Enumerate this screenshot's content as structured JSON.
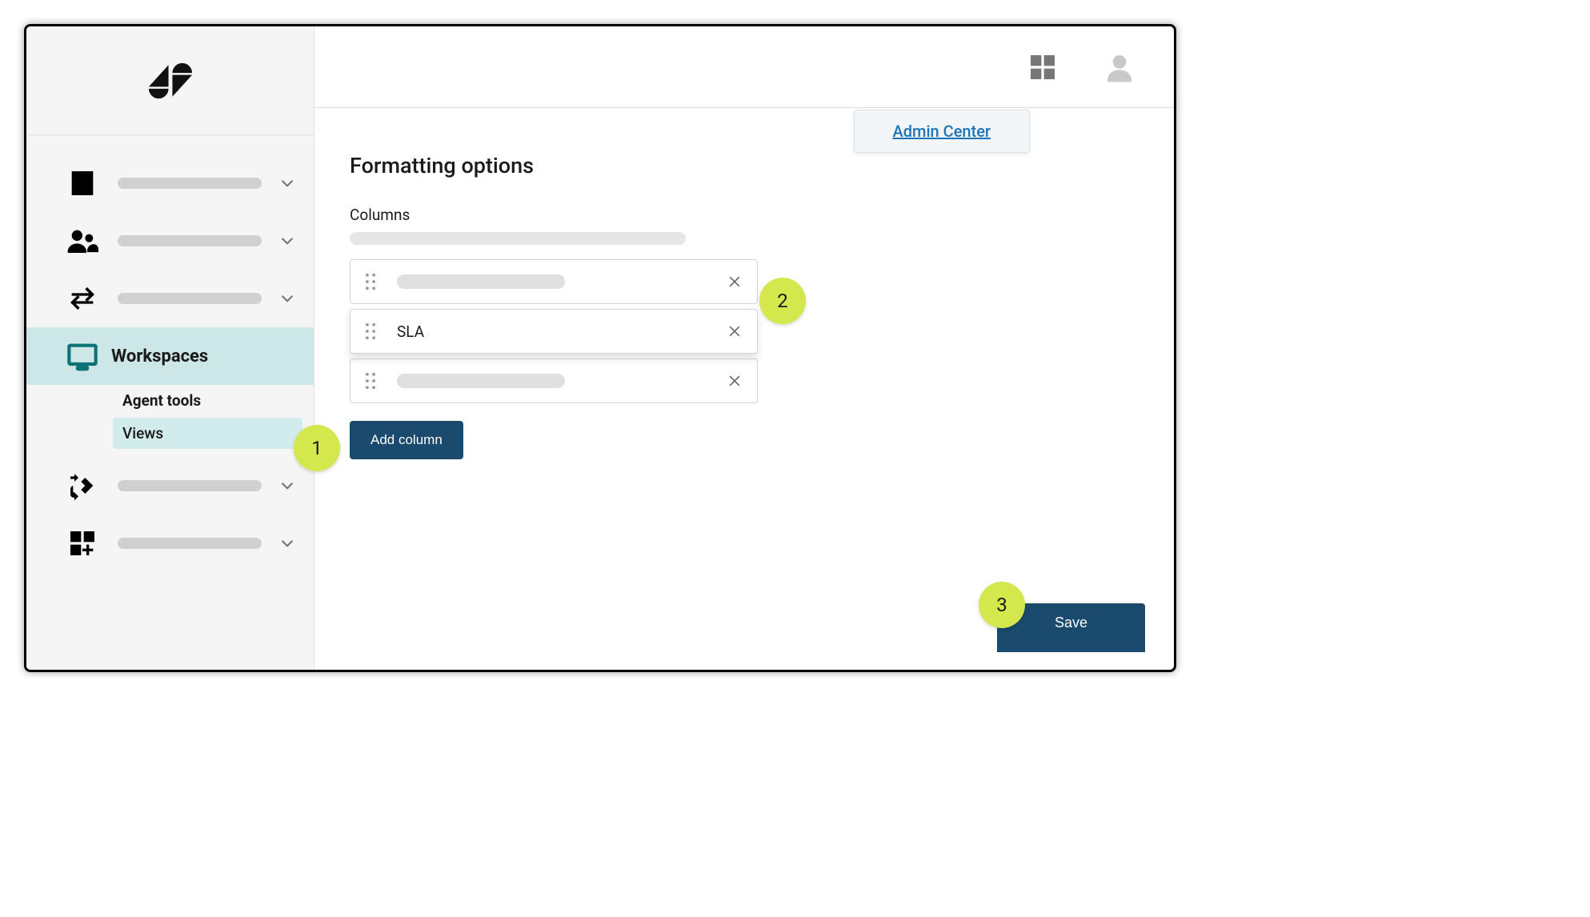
{
  "popover": {
    "link_text": "Admin Center"
  },
  "sidebar": {
    "active_label": "Workspaces",
    "sub_items": {
      "agent_tools": "Agent tools",
      "views": "Views"
    }
  },
  "content": {
    "heading": "Formatting options",
    "section_label": "Columns",
    "columns": {
      "sla": "SLA"
    },
    "add_button": "Add column"
  },
  "footer": {
    "save_button": "Save"
  },
  "callouts": {
    "one": "1",
    "two": "2",
    "three": "3"
  }
}
